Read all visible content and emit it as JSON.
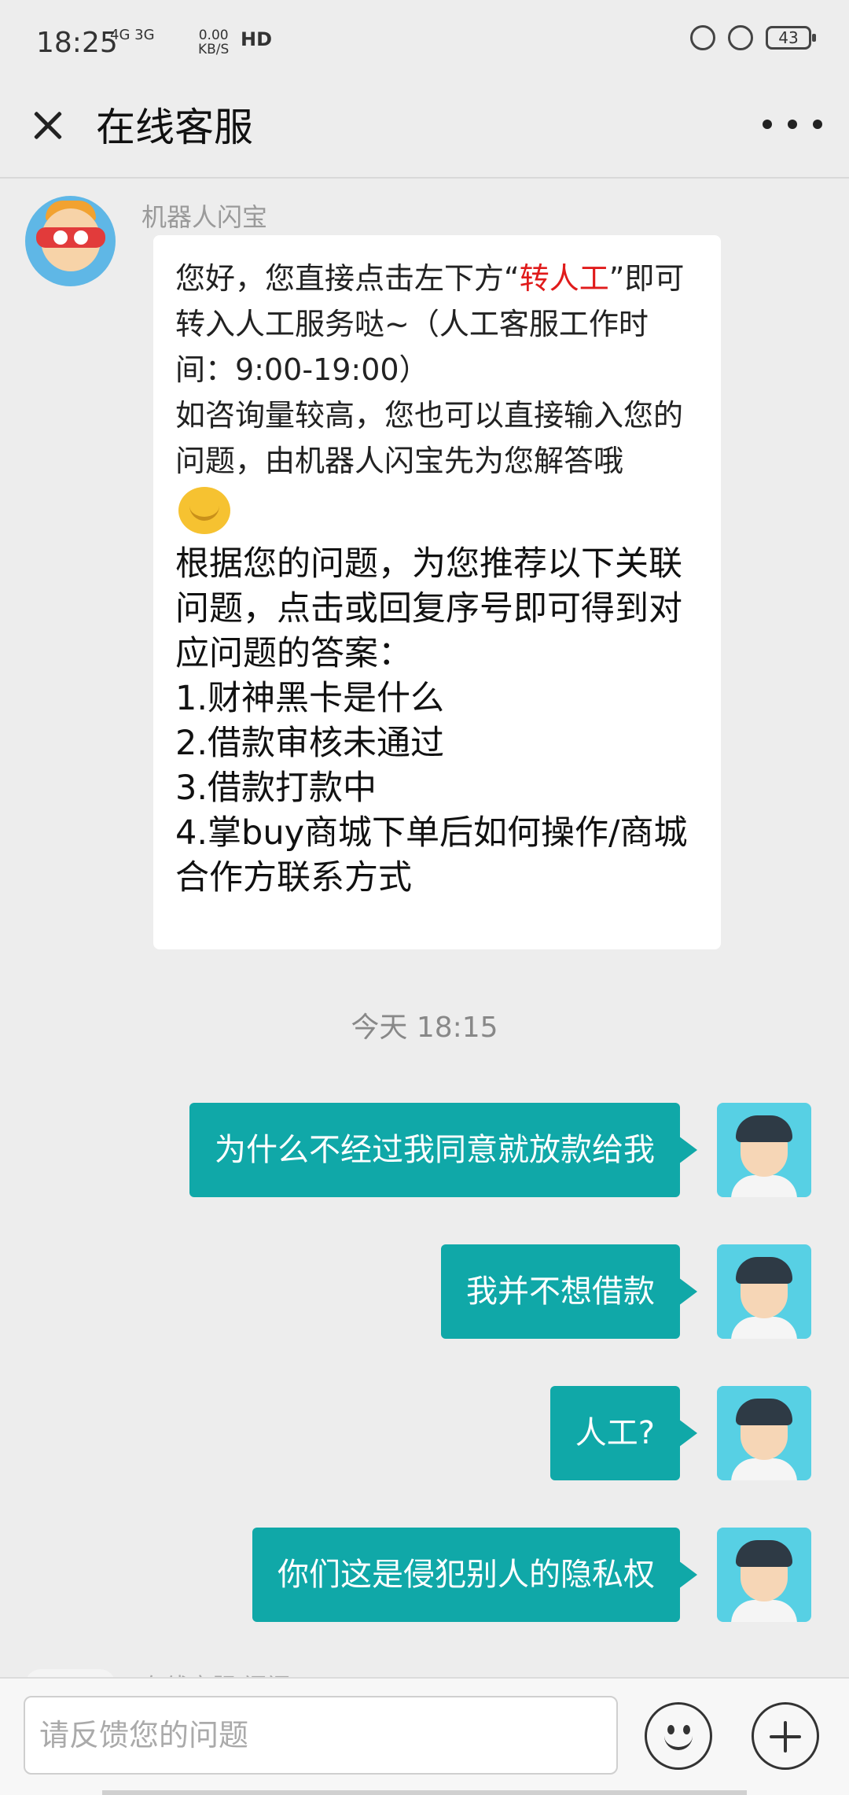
{
  "status_bar": {
    "time": "18:25",
    "network": "4G 3G",
    "speed_value": "0.00",
    "speed_unit": "KB/S",
    "hd": "HD",
    "battery": "43"
  },
  "header": {
    "title": "在线客服"
  },
  "bot": {
    "name": "机器人闪宝",
    "greeting_prefix": "您好，您直接点击左下方“",
    "greeting_link": "转人工",
    "greeting_suffix": "”即可转入人工服务哒~（人工客服工作时间：9:00-19:00）",
    "greeting_line2": "如咨询量较高，您也可以直接输入您的问题，由机器人闪宝先为您解答哦",
    "recommend_intro": "根据您的问题，为您推荐以下关联问题，点击或回复序号即可得到对应问题的答案：",
    "questions": [
      "1.财神黑卡是什么",
      "2.借款审核未通过",
      "3.借款打款中",
      "4.掌buy商城下单后如何操作/商城合作方联系方式"
    ]
  },
  "timestamp": "今天 18:15",
  "user_messages": [
    "为什么不经过我同意就放款给我",
    "我并不想借款",
    "人工?",
    "你们这是侵犯别人的隐私权"
  ],
  "next_sender_partial": "在线客服·闪闪",
  "input": {
    "placeholder": "请反馈您的问题"
  },
  "colors": {
    "user_bubble": "#10a8a8",
    "highlight_red": "#e01b1b",
    "background": "#ededed"
  }
}
